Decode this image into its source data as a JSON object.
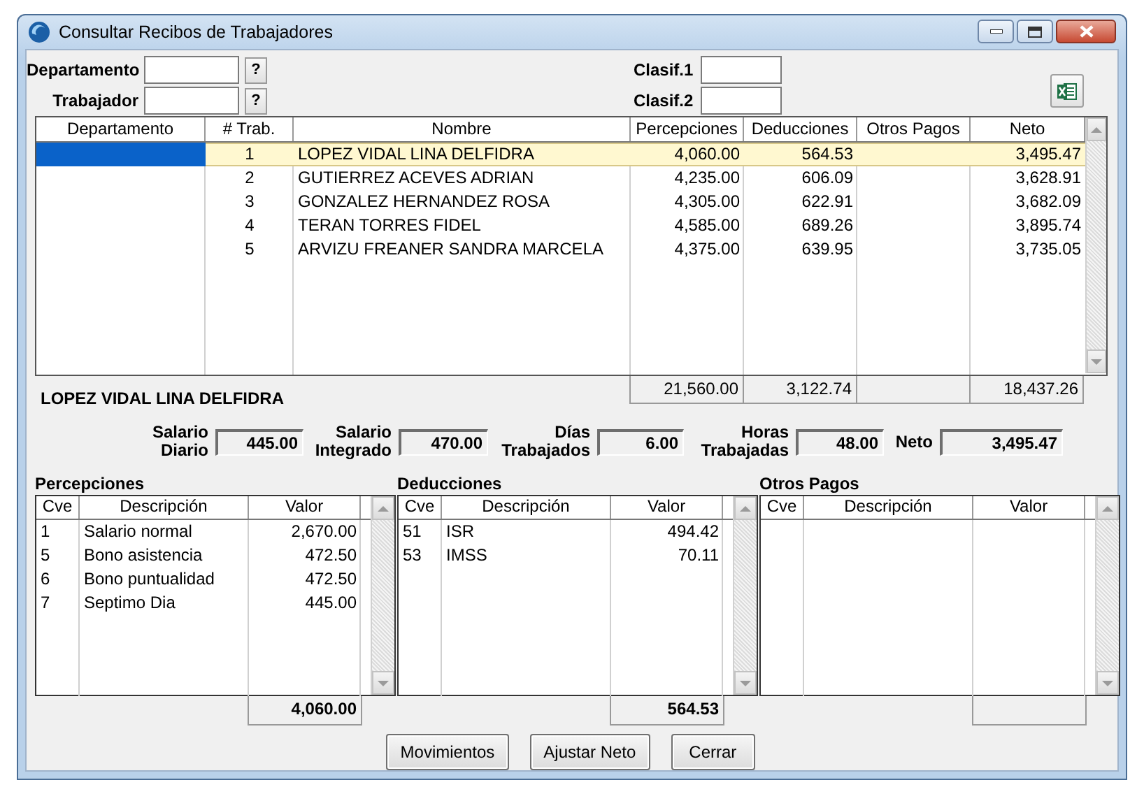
{
  "window": {
    "title": "Consultar Recibos de Trabajadores"
  },
  "filters": [
    {
      "label": "Departamento",
      "lookup": "?"
    },
    {
      "label": "Trabajador",
      "lookup": "?"
    }
  ],
  "classifications": [
    {
      "label": "Clasif.1"
    },
    {
      "label": "Clasif.2"
    }
  ],
  "table": {
    "columns": [
      "Departamento",
      "# Trab.",
      "Nombre",
      "Percepciones",
      "Deducciones",
      "Otros Pagos",
      "Neto"
    ],
    "rows": [
      {
        "number": "1",
        "name": "LOPEZ VIDAL LINA DELFIDRA",
        "perceptions": "4,060.00",
        "deductions": "564.53",
        "net": "3,495.47",
        "selected": true
      },
      {
        "number": "2",
        "name": "GUTIERREZ ACEVES ADRIAN",
        "perceptions": "4,235.00",
        "deductions": "606.09",
        "net": "3,628.91",
        "selected": false
      },
      {
        "number": "3",
        "name": "GONZALEZ HERNANDEZ ROSA",
        "perceptions": "4,305.00",
        "deductions": "622.91",
        "net": "3,682.09",
        "selected": false
      },
      {
        "number": "4",
        "name": "TERAN TORRES FIDEL",
        "perceptions": "4,585.00",
        "deductions": "689.26",
        "net": "3,895.74",
        "selected": false
      },
      {
        "number": "5",
        "name": "ARVIZU FREANER SANDRA MARCELA",
        "perceptions": "4,375.00",
        "deductions": "639.95",
        "net": "3,735.05",
        "selected": false
      }
    ],
    "totals": {
      "perceptions": "21,560.00",
      "deductions": "3,122.74",
      "net": "18,437.26"
    }
  },
  "selected_name": "LOPEZ VIDAL LINA DELFIDRA",
  "summary": [
    {
      "label": "Salario Diario",
      "value": "445.00"
    },
    {
      "label": "Salario Integrado",
      "value": "470.00"
    },
    {
      "label": "Días Trabajados",
      "value": "6.00"
    },
    {
      "label": "Horas Trabajadas",
      "value": "48.00"
    },
    {
      "label": "Neto",
      "value": "3,495.47"
    }
  ],
  "panels": [
    {
      "title": "Percepciones",
      "columns": [
        "Cve",
        "Descripción",
        "Valor"
      ],
      "rows": [
        [
          "1",
          "Salario normal",
          "2,670.00"
        ],
        [
          "5",
          "Bono asistencia",
          "472.50"
        ],
        [
          "6",
          "Bono puntualidad",
          "472.50"
        ],
        [
          "7",
          "Septimo Dia",
          "445.00"
        ]
      ],
      "total": "4,060.00"
    },
    {
      "title": "Deducciones",
      "columns": [
        "Cve",
        "Descripción",
        "Valor"
      ],
      "rows": [
        [
          "51",
          "ISR",
          "494.42"
        ],
        [
          "53",
          "IMSS",
          "70.11"
        ]
      ],
      "total": "564.53"
    },
    {
      "title": "Otros Pagos",
      "columns": [
        "Cve",
        "Descripción",
        "Valor"
      ]
    }
  ],
  "buttons": [
    "Movimientos",
    "Ajustar Neto",
    "Cerrar"
  ]
}
